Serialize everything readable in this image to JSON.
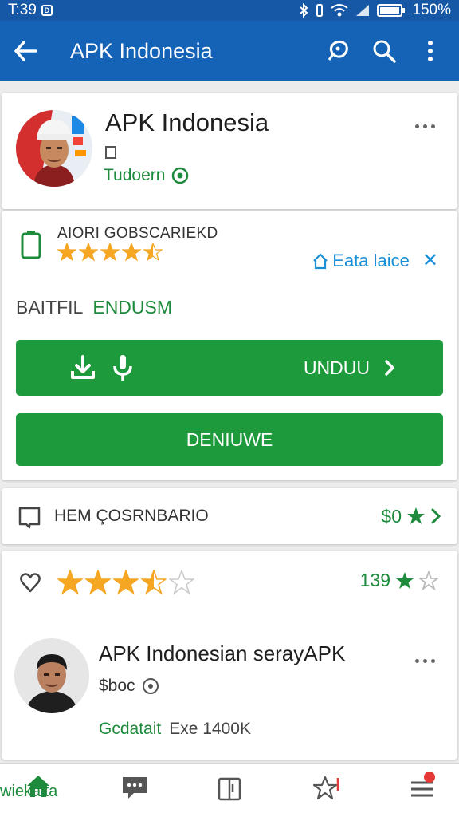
{
  "status_bar": {
    "time": "T:39",
    "battery": "150%"
  },
  "app_bar": {
    "title": "APK Indonesia"
  },
  "developer": {
    "name": "APK Indonesia",
    "subtitle": "Tudoern"
  },
  "rating_card": {
    "stats_label": "AIORI GOBSCARIEKD",
    "star_rating": 4.5,
    "link_label": "Eata laice",
    "battery_key": "BAITFIL",
    "battery_value": "ENDUSM"
  },
  "buttons": {
    "download_label": "UNDUU",
    "secondary_label": "DENIUWE"
  },
  "comment_row": {
    "label": "HEM ÇOSRNBARIO",
    "value": "$0"
  },
  "review": {
    "star_rating": 3.5,
    "count": "139",
    "title": "APK Indonesian serayAPK",
    "subtitle": "$boc",
    "meta_primary": "Gcdatait",
    "meta_secondary": "Exe 1400K"
  },
  "bottom_nav": {
    "home_label": "wiekalta"
  },
  "colors": {
    "app_bar": "#1463b6",
    "status_bar": "#1658a6",
    "primary_green": "#1d9a3c",
    "star": "#f5a623",
    "link_blue": "#1a8fd6"
  }
}
